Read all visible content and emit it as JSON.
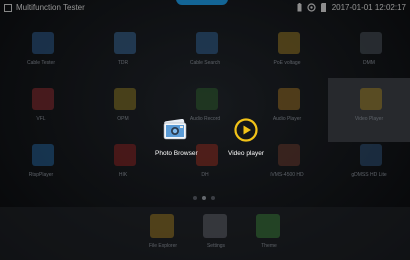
{
  "statusbar": {
    "title": "Multifunction Tester",
    "clock": "2017-01-01 12:02:17"
  },
  "apps": [
    {
      "label": "Cable Tester",
      "icon": "cable-tester-icon",
      "color": "#3a78b8"
    },
    {
      "label": "TDR",
      "icon": "tdr-icon",
      "color": "#4a86c5"
    },
    {
      "label": "Cable Search",
      "icon": "cable-search-icon",
      "color": "#3f7fc0"
    },
    {
      "label": "PoE voltage",
      "icon": "poe-voltage-icon",
      "color": "#c49a2e"
    },
    {
      "label": "DMM",
      "icon": "dmm-icon",
      "color": "#5f6a74"
    },
    {
      "label": "VFL",
      "icon": "vfl-icon",
      "color": "#b8383c"
    },
    {
      "label": "OPM",
      "icon": "opm-icon",
      "color": "#b59b2e"
    },
    {
      "label": "Audio Record",
      "icon": "audio-record-icon",
      "color": "#3d7a3a"
    },
    {
      "label": "Audio Player",
      "icon": "audio-player-icon",
      "color": "#c8902e"
    },
    {
      "label": "Video Player",
      "icon": "video-player-icon",
      "color": "#c8a22a"
    },
    {
      "label": "RtspPlayer",
      "icon": "rtsp-player-icon",
      "color": "#2f7fc8"
    },
    {
      "label": "HIK",
      "icon": "hik-icon",
      "color": "#b22b2b"
    },
    {
      "label": "DH",
      "icon": "dh-icon",
      "color": "#c23a2a"
    },
    {
      "label": "iVMS-4500 HD",
      "icon": "ivms-icon",
      "color": "#8a4a3a"
    },
    {
      "label": "gDMSS HD Lite",
      "icon": "gdmss-icon",
      "color": "#3d6a9a"
    }
  ],
  "dock": [
    {
      "label": "File Explorer",
      "icon": "file-explorer-icon",
      "color": "#c99a2a"
    },
    {
      "label": "Settings",
      "icon": "settings-icon",
      "color": "#7b8088"
    },
    {
      "label": "Theme",
      "icon": "theme-icon",
      "color": "#4aa34a"
    }
  ],
  "popup": {
    "photo_browser": "Photo Browser",
    "video_player": "Video player"
  },
  "page_indicator": {
    "pages": 3,
    "current": 2
  }
}
